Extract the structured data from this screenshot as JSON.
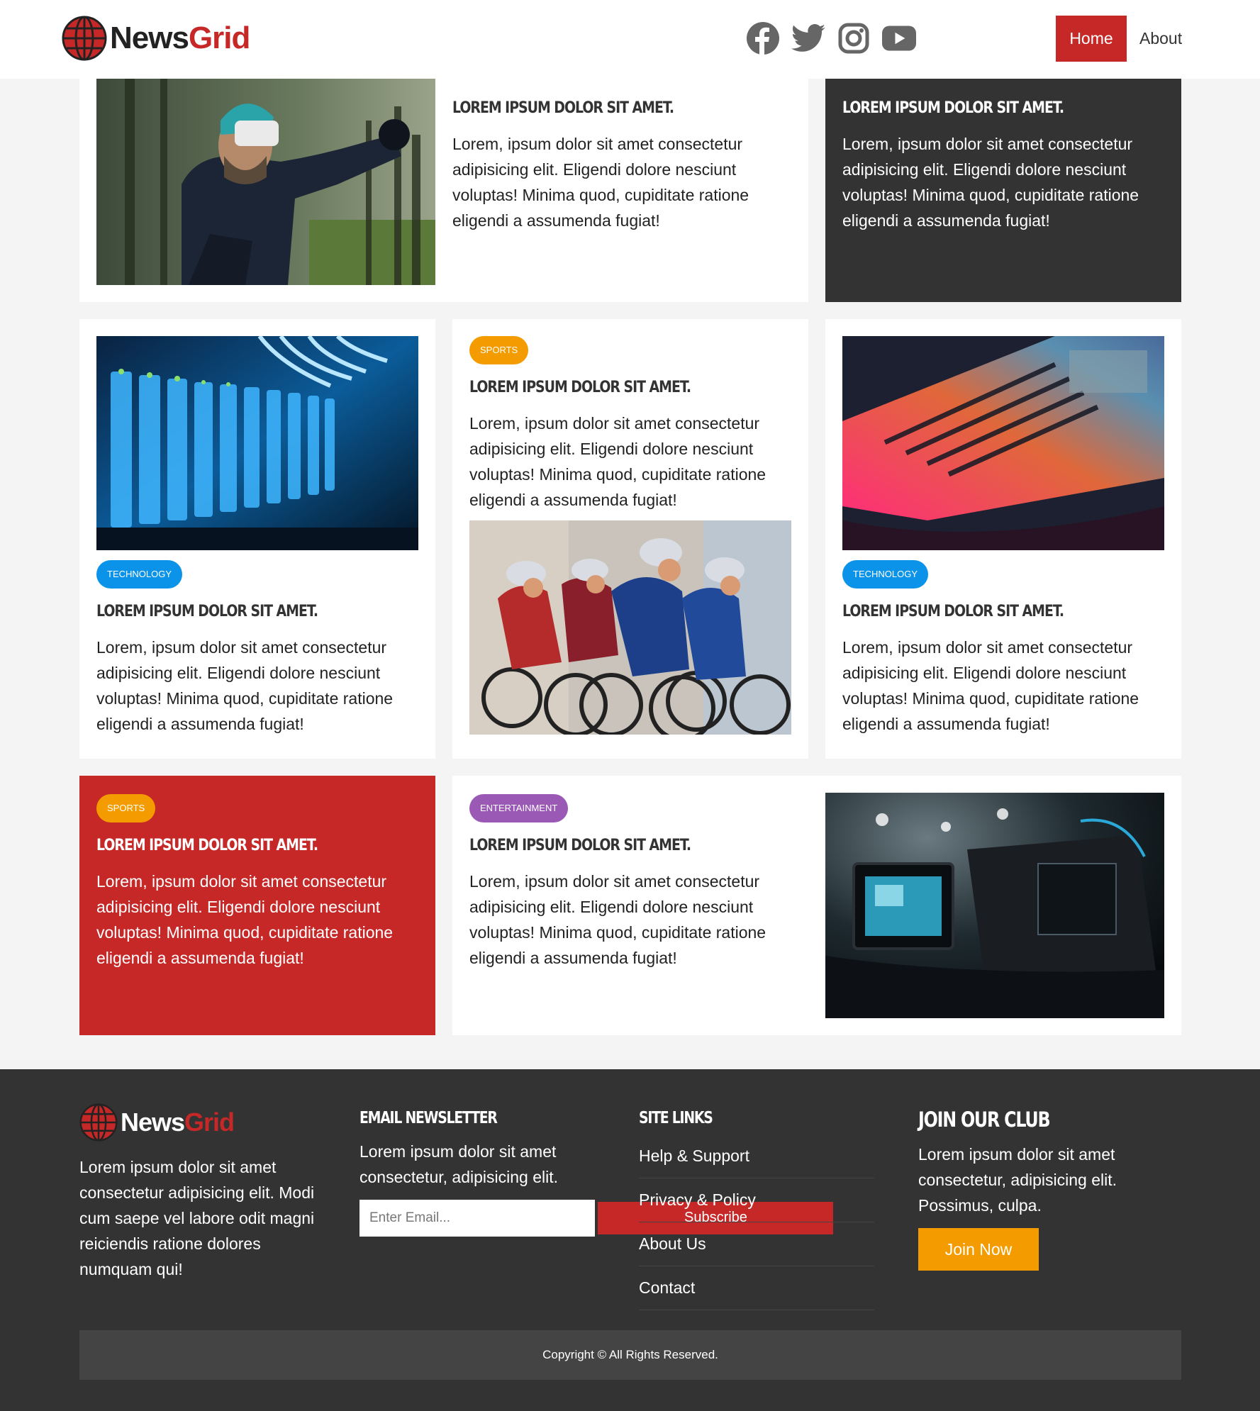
{
  "header": {
    "logo": {
      "part1": "News",
      "part2": "Grid"
    },
    "social": [
      "facebook-icon",
      "twitter-icon",
      "instagram-icon",
      "youtube-icon"
    ],
    "nav": {
      "home": "Home",
      "about": "About"
    }
  },
  "colors": {
    "brand_red": "#c62828",
    "technology": "#0a93e8",
    "sports": "#f49b00",
    "entertainment": "#9b59b6",
    "dark": "#333333"
  },
  "cards": [
    {
      "badge": "",
      "title": "LOREM IPSUM DOLOR SIT AMET.",
      "body": "Lorem, ipsum dolor sit amet consectetur adipisicing elit. Eligendi dolore nesciunt voluptas! Minima quod, cupiditate ratione eligendi a assumenda fugiat!",
      "image": "vr-headset-photo"
    },
    {
      "badge": "",
      "title": "LOREM IPSUM DOLOR SIT AMET.",
      "body": "Lorem, ipsum dolor sit amet consectetur adipisicing elit. Eligendi dolore nesciunt voluptas! Minima quod, cupiditate ratione eligendi a assumenda fugiat!"
    },
    {
      "badge": "TECHNOLOGY",
      "title": "LOREM IPSUM DOLOR SIT AMET.",
      "body": "Lorem, ipsum dolor sit amet consectetur adipisicing elit. Eligendi dolore nesciunt voluptas! Minima quod, cupiditate ratione eligendi a assumenda fugiat!",
      "image": "server-rack-photo"
    },
    {
      "badge": "SPORTS",
      "title": "LOREM IPSUM DOLOR SIT AMET.",
      "body": "Lorem, ipsum dolor sit amet consectetur adipisicing elit. Eligendi dolore nesciunt voluptas! Minima quod, cupiditate ratione eligendi a assumenda fugiat!",
      "image": "cyclists-photo"
    },
    {
      "badge": "TECHNOLOGY",
      "title": "LOREM IPSUM DOLOR SIT AMET.",
      "body": "Lorem, ipsum dolor sit amet consectetur adipisicing elit. Eligendi dolore nesciunt voluptas! Minima quod, cupiditate ratione eligendi a assumenda fugiat!",
      "image": "laptop-keyboard-photo"
    },
    {
      "badge": "SPORTS",
      "title": "LOREM IPSUM DOLOR SIT AMET.",
      "body": "Lorem, ipsum dolor sit amet consectetur adipisicing elit. Eligendi dolore nesciunt voluptas! Minima quod, cupiditate ratione eligendi a assumenda fugiat!"
    },
    {
      "badge": "ENTERTAINMENT",
      "title": "LOREM IPSUM DOLOR SIT AMET.",
      "body": "Lorem, ipsum dolor sit amet consectetur adipisicing elit. Eligendi dolore nesciunt voluptas! Minima quod, cupiditate ratione eligendi a assumenda fugiat!",
      "image": "video-camera-photo"
    }
  ],
  "footer": {
    "about_text": "Lorem ipsum dolor sit amet consectetur adipisicing elit. Modi cum saepe vel labore odit magni reiciendis ratione dolores numquam qui!",
    "newsletter": {
      "heading": "EMAIL NEWSLETTER",
      "text": "Lorem ipsum dolor sit amet consectetur, adipisicing elit.",
      "placeholder": "Enter Email...",
      "button": "Subscribe"
    },
    "site_links": {
      "heading": "SITE LINKS",
      "items": [
        "Help & Support",
        "Privacy & Policy",
        "About Us",
        "Contact"
      ]
    },
    "club": {
      "heading": "JOIN OUR CLUB",
      "text": "Lorem ipsum dolor sit amet consectetur, adipisicing elit. Possimus, culpa.",
      "button": "Join Now"
    },
    "copyright": "Copyright © All Rights Reserved."
  }
}
